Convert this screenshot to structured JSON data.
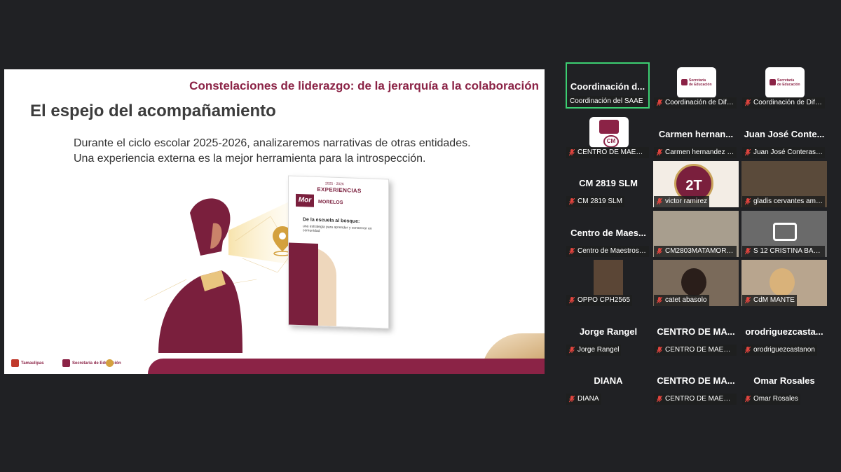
{
  "slide": {
    "header": "Constelaciones de liderazgo: de  la jerarquía a la colaboración",
    "title": "El espejo del acompañamiento",
    "body_line1": "Durante el ciclo escolar 2025-2026, analizaremos narrativas de otras entidades.",
    "body_line2": "Una experiencia externa es la mejor herramienta para la introspección.",
    "book": {
      "years": "2025 · 2026",
      "title": "EXPERIENCIAS",
      "logo": "Mor",
      "state": "MORELOS",
      "heading": "De la escuela al bosque:",
      "description": "una estrategia para aprender y conservar en comunidad"
    },
    "footer_logos": [
      "Tamaulipas",
      "Secretaría de Educación"
    ]
  },
  "participants": [
    {
      "name": "Coordinación d...",
      "label": "Coordinación del SAAE",
      "active": true,
      "muted": false
    },
    {
      "name": "",
      "label": "Coordinación de Difusi...",
      "muted": true,
      "avatar": "Secretaría de Educación"
    },
    {
      "name": "",
      "label": "Coordinación de Difusi...",
      "muted": true,
      "avatar": "Secretaría de Educación"
    },
    {
      "name": "",
      "label": "CENTRO DE MAESTRO...",
      "muted": true,
      "avatar": "CM"
    },
    {
      "name": "Carmen hernan...",
      "label": "Carmen hernandez ca...",
      "muted": true
    },
    {
      "name": "Juan José Conte...",
      "label": "Juan José Conteras Ne...",
      "muted": true
    },
    {
      "name": "CM 2819 SLM",
      "label": "CM 2819 SLM",
      "muted": true
    },
    {
      "name": "",
      "label": "victor ramirez",
      "muted": true,
      "avatar": "2T"
    },
    {
      "name": "",
      "label": "gladis cervantes amad...",
      "muted": true
    },
    {
      "name": "Centro de Maes...",
      "label": "Centro de Maestros 28...",
      "muted": true
    },
    {
      "name": "",
      "label": "CM2803MATAMOROS",
      "muted": true
    },
    {
      "name": "",
      "label": "S 12 CRISTINA BALDE...",
      "muted": true
    },
    {
      "name": "",
      "label": "OPPO CPH2565",
      "muted": true
    },
    {
      "name": "",
      "label": "catet abasolo",
      "muted": true
    },
    {
      "name": "",
      "label": "CdM MANTE",
      "muted": true
    },
    {
      "name": "Jorge Rangel",
      "label": "Jorge Rangel",
      "muted": true
    },
    {
      "name": "CENTRO DE MA...",
      "label": "CENTRO DE MAESTRO...",
      "muted": true
    },
    {
      "name": "orodriguezcasta...",
      "label": "orodriguezcastanon",
      "muted": true
    },
    {
      "name": "DIANA",
      "label": "DIANA",
      "muted": true
    },
    {
      "name": "CENTRO DE MA...",
      "label": "CENTRO DE MAESTRO...",
      "muted": true
    },
    {
      "name": "Omar Rosales",
      "label": "Omar Rosales",
      "muted": true
    }
  ],
  "colors": {
    "accent": "#8b2346",
    "active_border": "#3ccf72",
    "mic_muted": "#e0443e"
  }
}
